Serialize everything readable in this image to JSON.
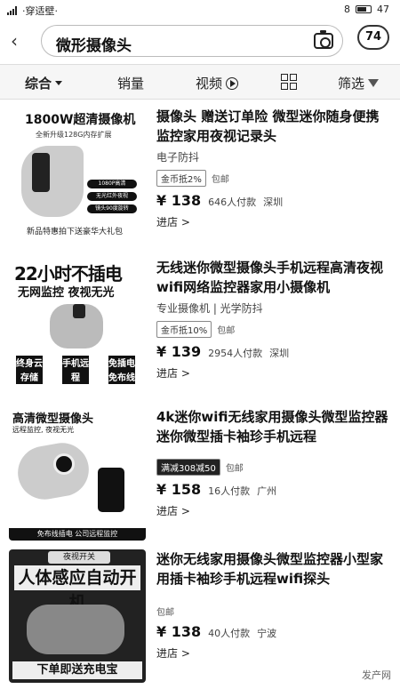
{
  "status_bar": {
    "left_text": "·穿适壁·",
    "time": "8",
    "right_text": "47"
  },
  "header": {
    "search_query": "微形摄像头",
    "cart_count": "74"
  },
  "filters": {
    "zonghe": "综合",
    "xiaoliang": "销量",
    "shipin": "视频",
    "shaixuan": "筛选"
  },
  "products": [
    {
      "thumb_title": "1800W超清摄像机",
      "thumb_sub": "全新升级128G内存扩展",
      "thumb_pills": [
        "1080P高清",
        "无光红外夜视",
        "镜头90度旋转"
      ],
      "thumb_footer": "新品特惠拍下送豪华大礼包",
      "title": "摄像头 赠送订单险 微型迷你随身便携监控家用夜视记录头",
      "shop": "电子防抖",
      "tags": [
        "金币抵2%",
        "包邮"
      ],
      "price": "¥ 138",
      "sold": "646人付款",
      "location": "深圳",
      "enter": "进店 >"
    },
    {
      "thumb_big": "22小时不插电",
      "thumb_mid": "无网监控 夜视无光",
      "thumb_boxes": [
        "终身云存储",
        "手机远程",
        "免插电免布线"
      ],
      "title": "无线迷你微型摄像头手机远程高清夜视wifi网络监控器家用小摄像机",
      "shop": "专业摄像机 | 光学防抖",
      "tags": [
        "金币抵10%",
        "包邮"
      ],
      "price": "¥ 139",
      "sold": "2954人付款",
      "location": "深圳",
      "enter": "进店 >"
    },
    {
      "thumb_head": "高清微型摄像头",
      "thumb_head2": "远程监控, 夜视无光",
      "thumb_bar": "免布线插电 公司远程监控",
      "title": "4k迷你wifi无线家用摄像头微型监控器迷你微型插卡袖珍手机远程",
      "shop": "",
      "tags": [
        "满减308减50",
        "包邮"
      ],
      "price": "¥ 158",
      "sold": "16人付款",
      "location": "广州",
      "enter": "进店 >"
    },
    {
      "thumb_top": "夜视开关",
      "thumb_big": "人体感应自动开机",
      "thumb_footer": "下单即送充电宝",
      "title": "迷你无线家用摄像头微型监控器小型家用插卡袖珍手机远程wifi探头",
      "shop": "",
      "tags": [
        "包邮"
      ],
      "price": "¥ 138",
      "sold": "40人付款",
      "location": "宁波",
      "enter": "进店 >"
    }
  ],
  "watermark": "发产网"
}
